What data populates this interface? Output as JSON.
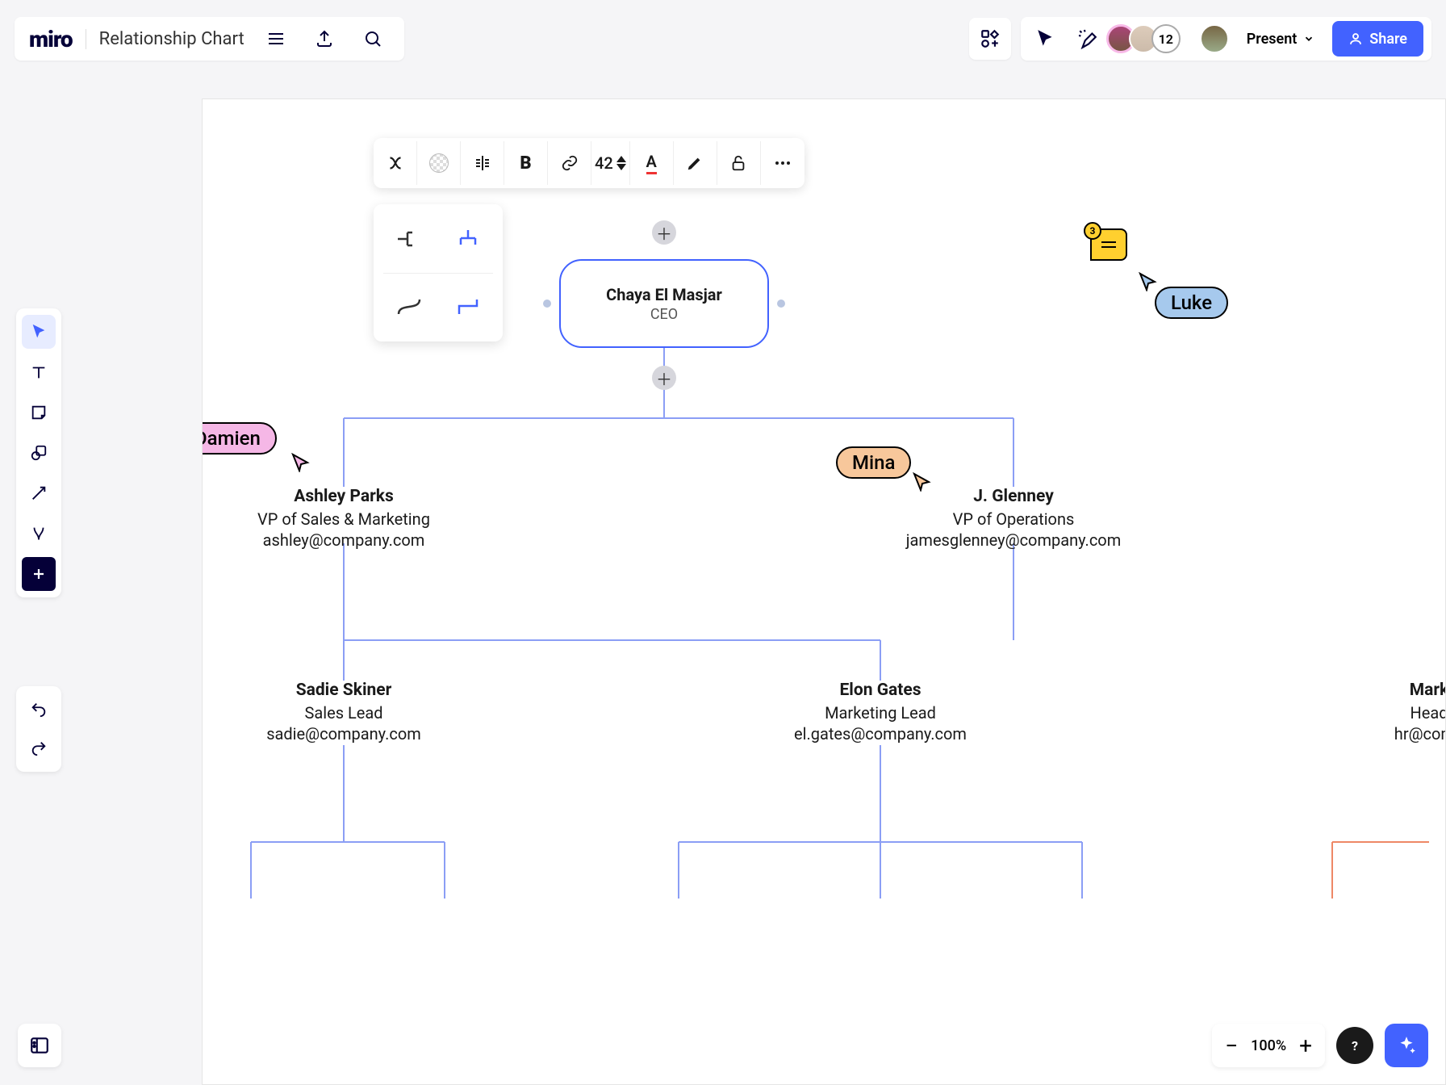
{
  "app": {
    "logo": "miro",
    "title": "Relationship Chart",
    "collaborator_count": "12",
    "present_label": "Present",
    "share_label": "Share"
  },
  "context_toolbar": {
    "font_size": "42"
  },
  "people": {
    "ceo": {
      "name": "Chaya El Masjar",
      "role": "CEO"
    },
    "vp_sales": {
      "name": "Ashley Parks",
      "role": "VP of Sales & Marketing",
      "email": "ashley@company.com"
    },
    "vp_ops": {
      "name": "J. Glenney",
      "role": "VP of Operations",
      "email": "jamesglenney@company.com"
    },
    "sales_lead": {
      "name": "Sadie Skiner",
      "role": "Sales Lead",
      "email": "sadie@company.com"
    },
    "mkt_lead": {
      "name": "Elon Gates",
      "role": "Marketing Lead",
      "email": "el.gates@company.com"
    },
    "hr_partial": {
      "name": "Mark",
      "role": "Head",
      "email": "hr@comp"
    }
  },
  "cursors": {
    "damien": "Damien",
    "mina": "Mina",
    "luke": "Luke"
  },
  "comment_badge": "3",
  "zoom": "100%"
}
